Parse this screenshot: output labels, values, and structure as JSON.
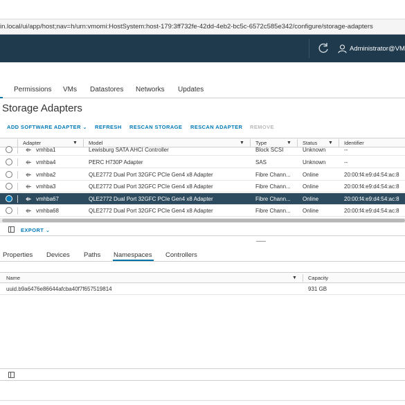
{
  "browser": {
    "url": "in.local/ui/app/host;nav=h/urn:vmomi:HostSystem:host-179:3ff732fe-42dd-4eb2-bc5c-6572c585e342/configure/storage-adapters"
  },
  "header": {
    "user_label": "Administrator@VMV"
  },
  "top_tabs": [
    "Permissions",
    "VMs",
    "Datastores",
    "Networks",
    "Updates"
  ],
  "page_title": "Storage Adapters",
  "actions": {
    "add_software_adapter": "ADD SOFTWARE ADAPTER",
    "refresh": "REFRESH",
    "rescan_storage": "RESCAN STORAGE",
    "rescan_adapter": "RESCAN ADAPTER",
    "remove": "REMOVE"
  },
  "adapters_grid": {
    "columns": [
      "Adapter",
      "Model",
      "Type",
      "Status",
      "Identifier"
    ],
    "rows": [
      {
        "adapter": "vmhba1",
        "model": "Lewisburg SATA AHCI Controller",
        "type": "Block SCSI",
        "status": "Unknown",
        "identifier": "--",
        "selected": false
      },
      {
        "adapter": "vmhba4",
        "model": "PERC H730P Adapter",
        "type": "SAS",
        "status": "Unknown",
        "identifier": "--",
        "selected": false
      },
      {
        "adapter": "vmhba2",
        "model": "QLE2772 Dual Port 32GFC PCIe Gen4 x8 Adapter",
        "type": "Fibre Chann...",
        "status": "Online",
        "identifier": "20:00:f4:e9:d4:54:ac:8",
        "selected": false
      },
      {
        "adapter": "vmhba3",
        "model": "QLE2772 Dual Port 32GFC PCIe Gen4 x8 Adapter",
        "type": "Fibre Chann...",
        "status": "Online",
        "identifier": "20:00:f4:e9:d4:54:ac:8",
        "selected": false
      },
      {
        "adapter": "vmhba67",
        "model": "QLE2772 Dual Port 32GFC PCIe Gen4 x8 Adapter",
        "type": "Fibre Chann...",
        "status": "Online",
        "identifier": "20:00:f4:e9:d4:54:ac:8",
        "selected": true
      },
      {
        "adapter": "vmhba68",
        "model": "QLE2772 Dual Port 32GFC PCIe Gen4 x8 Adapter",
        "type": "Fibre Chann...",
        "status": "Online",
        "identifier": "20:00:f4:e9:d4:54:ac:8",
        "selected": false
      }
    ],
    "export_label": "EXPORT"
  },
  "bottom_tabs": [
    "Properties",
    "Devices",
    "Paths",
    "Namespaces",
    "Controllers"
  ],
  "active_bottom_tab": "Namespaces",
  "namespaces_grid": {
    "columns": [
      "Name",
      "Capacity"
    ],
    "rows": [
      {
        "name": "uuid.b9a6476e86644afcba40f7f657519814",
        "capacity": "931 GB"
      }
    ]
  },
  "colors": {
    "header_bg": "#1f3a4d",
    "accent": "#0079b8",
    "selected_row": "#2c4b5e"
  }
}
